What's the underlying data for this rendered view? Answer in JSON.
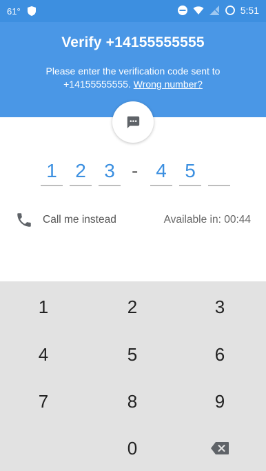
{
  "status_bar": {
    "temperature": "61°",
    "time": "5:51",
    "icons": [
      "shield-icon",
      "do-not-disturb-icon",
      "wifi-icon",
      "no-signal-icon",
      "battery-charging-icon"
    ]
  },
  "header": {
    "title": "Verify +14155555555",
    "subtitle_prefix": "Please enter the verification code sent to +14155555555.",
    "wrong_number_link": "Wrong number?",
    "badge_icon": "chat-bubble-icon"
  },
  "code": {
    "digits": [
      "1",
      "2",
      "3",
      "4",
      "5",
      ""
    ],
    "separator": "-"
  },
  "call_row": {
    "icon": "phone-icon",
    "label": "Call me instead",
    "available": "Available in: 00:44"
  },
  "keypad": {
    "keys": [
      "1",
      "2",
      "3",
      "4",
      "5",
      "6",
      "7",
      "8",
      "9",
      "0"
    ],
    "backspace_icon": "backspace-icon"
  },
  "colors": {
    "header": "#4a97e6",
    "status_bar": "#3d8fe0",
    "digit": "#3b8fe0",
    "keypad_bg": "#e2e2e2"
  }
}
